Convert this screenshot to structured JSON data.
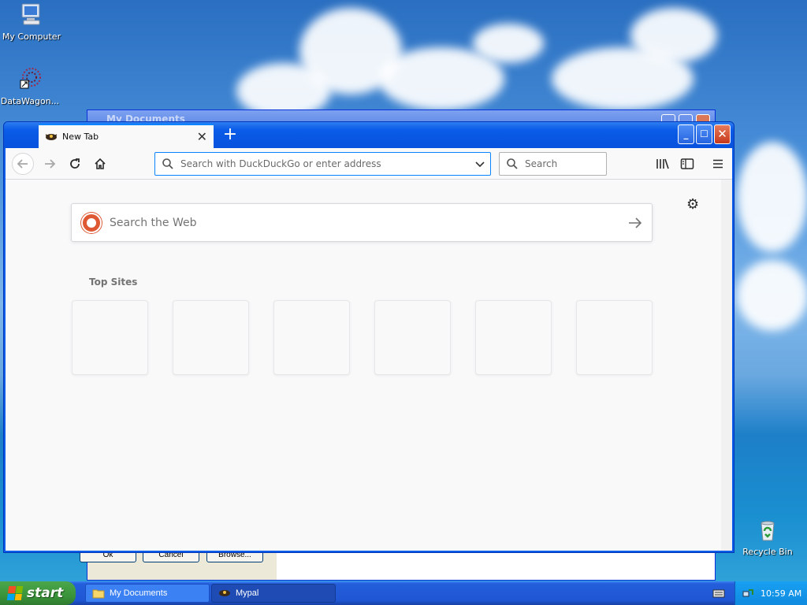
{
  "desktop": {
    "icons": [
      {
        "label": "My Computer"
      },
      {
        "label": "DataWagon..."
      },
      {
        "label": "Recycle Bin"
      }
    ]
  },
  "background_window": {
    "title": "My Documents",
    "buttons": [
      "Ok",
      "Cancel",
      "Browse..."
    ]
  },
  "browser": {
    "tab_title": "New Tab",
    "url_placeholder": "Search with DuckDuckGo or enter address",
    "search_placeholder": "Search",
    "web_search_placeholder": "Search the Web",
    "top_sites_label": "Top Sites",
    "top_sites_count": 6
  },
  "taskbar": {
    "start_label": "start",
    "items": [
      {
        "label": "My Documents"
      },
      {
        "label": "Mypal"
      }
    ],
    "clock": "10:59 AM"
  },
  "colors": {
    "accent": "#0a84ff",
    "xp_titlebar": "#0a5ce8",
    "start_green": "#3a953a",
    "duckduckgo": "#de5833"
  }
}
